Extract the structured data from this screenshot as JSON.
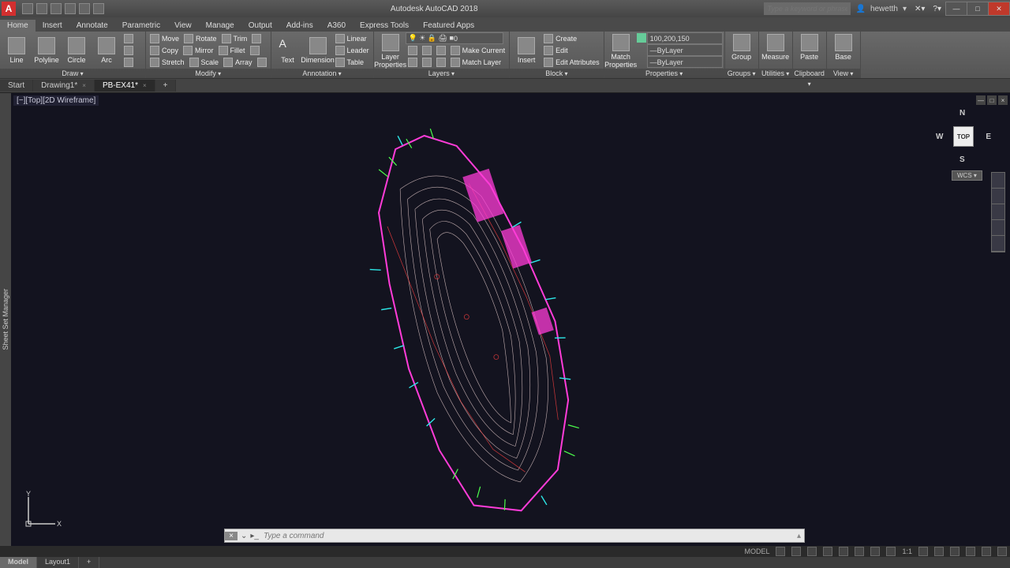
{
  "app": {
    "title": "Autodesk AutoCAD 2018",
    "logo": "A",
    "search_placeholder": "Type a keyword or phrase",
    "user": "hewetth"
  },
  "win": {
    "min": "—",
    "max": "□",
    "close": "✕"
  },
  "ribbon_tabs": [
    "Home",
    "Insert",
    "Annotate",
    "Parametric",
    "View",
    "Manage",
    "Output",
    "Add-ins",
    "A360",
    "Express Tools",
    "Featured Apps"
  ],
  "panels": {
    "draw": {
      "label": "Draw",
      "btns": [
        "Line",
        "Polyline",
        "Circle",
        "Arc"
      ]
    },
    "modify": {
      "label": "Modify",
      "rows": [
        [
          "Move",
          "Rotate",
          "Trim"
        ],
        [
          "Copy",
          "Mirror",
          "Fillet"
        ],
        [
          "Stretch",
          "Scale",
          "Array"
        ]
      ]
    },
    "annotation": {
      "label": "Annotation",
      "text": "Text",
      "dim": "Dimension",
      "side": [
        "Linear",
        "Leader",
        "Table"
      ]
    },
    "layers": {
      "label": "Layers",
      "lp": "Layer\nProperties",
      "current": "0",
      "make": "Make Current",
      "match": "Match Layer"
    },
    "block": {
      "label": "Block",
      "insert": "Insert",
      "create": "Create",
      "edit": "Edit",
      "editattr": "Edit Attributes"
    },
    "properties": {
      "label": "Properties",
      "match": "Match\nProperties",
      "color": "100,200,150",
      "lt1": "ByLayer",
      "lt2": "ByLayer"
    },
    "groups": {
      "label": "Groups",
      "group": "Group"
    },
    "utilities": {
      "label": "Utilities",
      "measure": "Measure"
    },
    "clipboard": {
      "label": "Clipboard",
      "paste": "Paste"
    },
    "view": {
      "label": "View",
      "base": "Base"
    }
  },
  "doc_tabs": {
    "start": "Start",
    "d1": "Drawing1*",
    "d2": "PB-EX41*",
    "plus": "+"
  },
  "viewport": {
    "label": "[−][Top][2D Wireframe]"
  },
  "viewcube": {
    "top": "TOP",
    "n": "N",
    "s": "S",
    "e": "E",
    "w": "W",
    "wcs": "WCS"
  },
  "ucs": {
    "x": "X",
    "y": "Y"
  },
  "cmd": {
    "placeholder": "Type a command",
    "x": "×"
  },
  "bottom_tabs": [
    "Model",
    "Layout1"
  ],
  "status": {
    "model": "MODEL",
    "scale": "1:1"
  }
}
